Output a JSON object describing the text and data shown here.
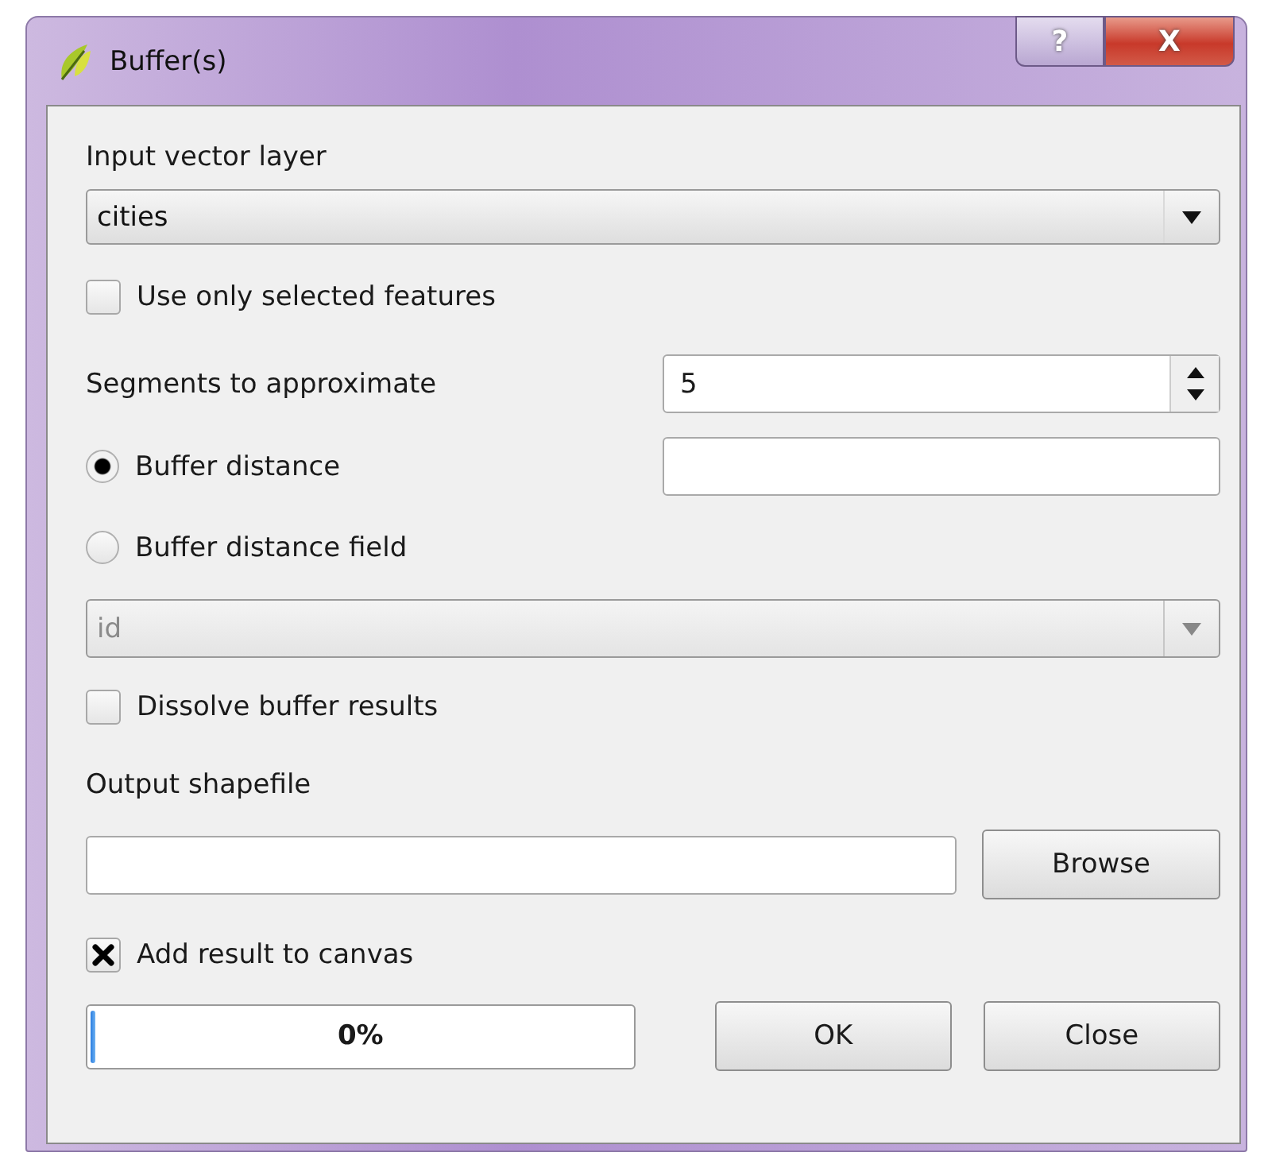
{
  "window": {
    "title": "Buffer(s)",
    "help_button": "?",
    "close_button": "X"
  },
  "input_layer": {
    "label": "Input vector layer",
    "value": "cities",
    "disabled": false
  },
  "selected_only": {
    "label": "Use only selected features",
    "checked": false
  },
  "segments": {
    "label": "Segments to approximate",
    "value": "5"
  },
  "distance_options": [
    {
      "label": "Buffer distance",
      "selected": true
    },
    {
      "label": "Buffer distance field",
      "selected": false
    }
  ],
  "distance_field": {
    "value": "id",
    "disabled": true
  },
  "dissolve": {
    "label": "Dissolve buffer results",
    "checked": false
  },
  "output": {
    "label": "Output shapefile",
    "browse": "Browse"
  },
  "add_to_canvas": {
    "label": "Add result to canvas",
    "checked": true
  },
  "progress": {
    "text": "0%",
    "level": 0.006
  },
  "buttons": [
    "OK",
    "Close"
  ]
}
